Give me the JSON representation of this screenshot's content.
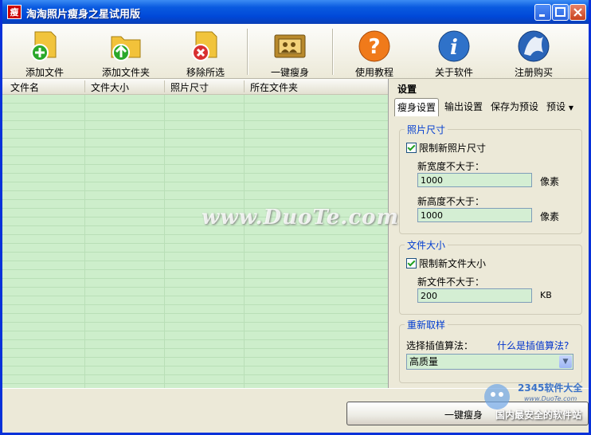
{
  "window": {
    "title": "淘淘照片瘦身之星试用版",
    "app_icon_glyph": "瘦"
  },
  "toolbar": {
    "items": [
      {
        "label": "添加文件",
        "icon": "add-file-icon"
      },
      {
        "label": "添加文件夹",
        "icon": "add-folder-icon"
      },
      {
        "label": "移除所选",
        "icon": "remove-selected-icon"
      },
      {
        "label": "一键瘦身",
        "icon": "photo-slim-icon"
      },
      {
        "label": "使用教程",
        "icon": "help-icon"
      },
      {
        "label": "关于软件",
        "icon": "info-icon"
      },
      {
        "label": "注册购买",
        "icon": "register-icon"
      }
    ]
  },
  "file_list": {
    "columns": [
      "文件名",
      "文件大小",
      "照片尺寸",
      "所在文件夹"
    ]
  },
  "settings": {
    "title": "设置",
    "tabs": [
      "瘦身设置",
      "输出设置",
      "保存为预设",
      "预设"
    ],
    "photo_size": {
      "group_title": "照片尺寸",
      "checkbox_label": "限制新照片尺寸",
      "checked": true,
      "width_label": "新宽度不大于：",
      "width_value": "1000",
      "height_label": "新高度不大于：",
      "height_value": "1000",
      "unit": "像素"
    },
    "file_size": {
      "group_title": "文件大小",
      "checkbox_label": "限制新文件大小",
      "checked": true,
      "size_label": "新文件不大于：",
      "size_value": "200",
      "unit": "KB"
    },
    "resample": {
      "group_title": "重新取样",
      "algo_label": "选择插值算法：",
      "help_link": "什么是插值算法?",
      "selected": "高质量"
    }
  },
  "bottom": {
    "slim_button": "一键瘦身"
  },
  "overlays": {
    "watermark": "www.DuoTe.com",
    "corner_brand": "2345软件大全",
    "corner_site": "www.DuoTe.com",
    "corner_tag": "国内最安全的软件站"
  },
  "colors": {
    "title_bar": "#0a5be0",
    "list_bg": "#cdeecb",
    "group_title": "#003cd0",
    "link": "#0033cc"
  }
}
